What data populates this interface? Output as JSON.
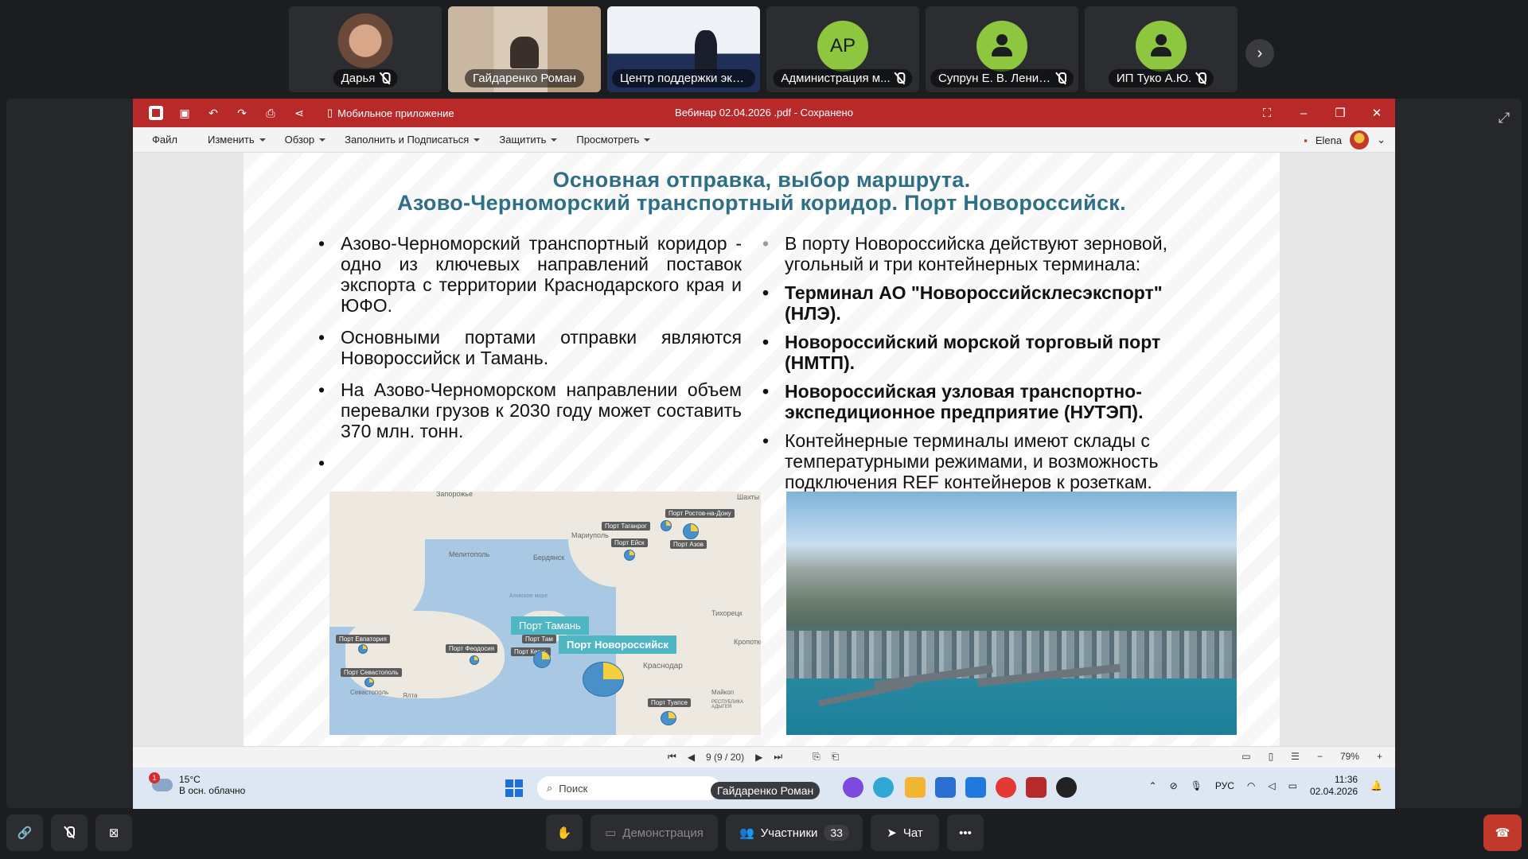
{
  "participants": [
    {
      "name": "Дарья",
      "kind": "photo1",
      "muted": true
    },
    {
      "name": "Гайдаренко Роман",
      "kind": "photo2",
      "muted": false,
      "active": true
    },
    {
      "name": "Центр поддержки экс...",
      "kind": "photo3",
      "muted": false
    },
    {
      "name": "Администрация м...",
      "kind": "initials",
      "initials": "АР",
      "muted": true
    },
    {
      "name": "Супрун Е. В. Ленин...",
      "kind": "person",
      "muted": true
    },
    {
      "name": "ИП Туко А.Ю.",
      "kind": "person",
      "muted": true
    }
  ],
  "app": {
    "mobile_app_label": "Мобильное приложение",
    "window_title": "Вебинар  02.04.2026 .pdf - Сохранено",
    "menu": [
      "Файл",
      "Изменить",
      "Обзор",
      "Заполнить и Подписаться",
      "Защитить",
      "Просмотреть"
    ],
    "user": "Elena"
  },
  "slide": {
    "title_line1": "Основная отправка, выбор маршрута.",
    "title_line2": "Азово-Черноморский транспортный коридор. Порт Новороссийск.",
    "left_bullets": [
      "Азово-Черноморский транспортный коридор - одно из ключевых направлений поставок экспорта с территории Краснодарского края и ЮФО.",
      "Основными портами отправки являются Новороссийск и Тамань.",
      "На Азово-Черноморском направлении объем перевалки грузов к 2030 году может составить 370 млн. тонн.",
      ""
    ],
    "right_intro": "В порту Новороссийска действуют зерновой, угольный и три контейнерных терминала:",
    "right_bold": [
      "Терминал АО \"Новороссийсклесэкспорт\"(НЛЭ).",
      "Новороссийский морской торговый порт (НМТП).",
      "Новороссийская узловая транспортно-экспедиционное предприятие (НУТЭП)."
    ],
    "right_last": "Контейнерные терминалы имеют склады с температурными режимами, и возможность подключения REF контейнеров к розеткам.",
    "map": {
      "tag_taman": "Порт Тамань",
      "tag_novoross": "Порт Новороссийск",
      "labels": [
        "Порт Таганрог",
        "Порт Ростов-на-Дону",
        "Порт Ейск",
        "Порт Азов",
        "Порт Евпатория",
        "Порт Феодосия",
        "Порт Керчь",
        "Порт Севастополь",
        "Порт Туапсе",
        "Порт Там"
      ],
      "places": [
        "Запорожье",
        "Шахты",
        "Мариуполь",
        "Мелитополь",
        "Бердянск",
        "Азовское море",
        "Тихорецк",
        "Кропоткин",
        "Краснодар",
        "Майкоп",
        "Севастополь",
        "Ялта",
        "РЕСПУБЛИКА АДЫГЕЯ"
      ]
    }
  },
  "status": {
    "page": "9 (9 / 20)",
    "zoom": "79%"
  },
  "taskbar": {
    "temp": "15°C",
    "weather": "В осн. облачно",
    "badge": "1",
    "search": "Поиск",
    "speaker": "Гайдаренко Роман",
    "lang": "РУС",
    "time": "11:36",
    "date": "02.04.2026"
  },
  "toolbar": {
    "demo": "Демонстрация",
    "participants": "Участники",
    "participants_count": "33",
    "chat": "Чат"
  }
}
